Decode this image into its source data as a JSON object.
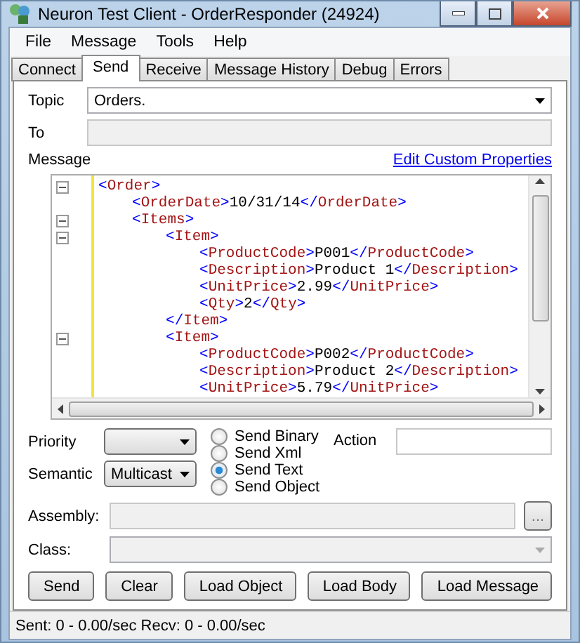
{
  "window": {
    "title": "Neuron Test Client - OrderResponder (24924)"
  },
  "menu": [
    "File",
    "Message",
    "Tools",
    "Help"
  ],
  "tabs": [
    {
      "label": "Connect",
      "selected": false
    },
    {
      "label": "Send",
      "selected": true
    },
    {
      "label": "Receive",
      "selected": false
    },
    {
      "label": "Message History",
      "selected": false
    },
    {
      "label": "Debug",
      "selected": false
    },
    {
      "label": "Errors",
      "selected": false
    }
  ],
  "topic": {
    "label": "Topic",
    "value": "Orders."
  },
  "to": {
    "label": "To"
  },
  "message": {
    "label": "Message",
    "link": "Edit Custom Properties",
    "xml": [
      {
        "line": "<Order>",
        "children": [
          {
            "line": "<OrderDate>10/31/14</OrderDate>"
          },
          {
            "line": "<Items>",
            "children": [
              {
                "line": "<Item>",
                "children": [
                  {
                    "line": "<ProductCode>P001</ProductCode>"
                  },
                  {
                    "line": "<Description>Product 1</Description>"
                  },
                  {
                    "line": "<UnitPrice>2.99</UnitPrice>"
                  },
                  {
                    "line": "<Qty>2</Qty>"
                  }
                ]
              },
              {
                "line": "</Item>"
              },
              {
                "line": "<Item>",
                "children": [
                  {
                    "line": "<ProductCode>P002</ProductCode>"
                  },
                  {
                    "line": "<Description>Product 2</Description>"
                  },
                  {
                    "line": "<UnitPrice>5.79</UnitPrice>"
                  }
                ]
              }
            ]
          }
        ]
      }
    ]
  },
  "priority": {
    "label": "Priority"
  },
  "semantic": {
    "label": "Semantic",
    "value": "Multicast"
  },
  "send_modes": [
    {
      "label": "Send Binary",
      "selected": false
    },
    {
      "label": "Send Xml",
      "selected": false
    },
    {
      "label": "Send Text",
      "selected": true
    },
    {
      "label": "Send Object",
      "selected": false
    }
  ],
  "action": {
    "label": "Action"
  },
  "assembly": {
    "label": "Assembly:",
    "browse": "..."
  },
  "class": {
    "label": "Class:"
  },
  "buttons": [
    "Send",
    "Clear",
    "Load Object",
    "Load Body",
    "Load Message"
  ],
  "status_bar": "Sent: 0  -  0.00/sec  Recv: 0  -  0.00/sec"
}
